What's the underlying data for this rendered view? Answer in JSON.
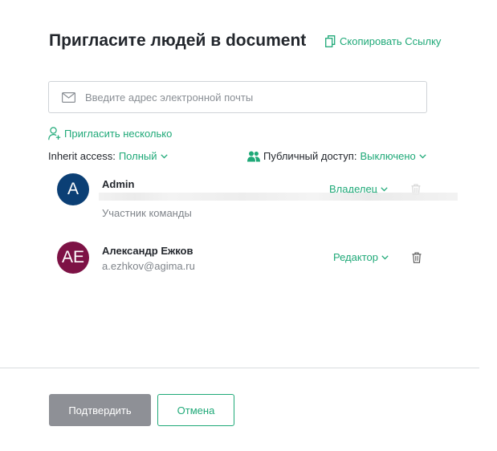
{
  "dialog": {
    "title": "Пригласите людей в document",
    "copy_link_label": "Скопировать Ссылку",
    "email": {
      "placeholder": "Введите адрес электронной почты",
      "value": ""
    },
    "invite_multiple_label": "Пригласить несколько",
    "inherit_access": {
      "label": "Inherit access:",
      "value": "Полный"
    },
    "public_access": {
      "label": "Публичный доступ:",
      "value": "Выключено"
    },
    "members": [
      {
        "initials": "A",
        "avatar_color": "#0b3f75",
        "name": "Admin",
        "subtitle": "Участник команды",
        "role": "Владелец"
      },
      {
        "initials": "АЕ",
        "avatar_color": "#7d1245",
        "name": "Александр Ежков",
        "subtitle": "a.ezhkov@agima.ru",
        "role": "Редактор"
      }
    ],
    "buttons": {
      "confirm_label": "Подтвердить",
      "cancel_label": "Отмена"
    },
    "colors": {
      "accent": "#1fa978",
      "confirm_bg": "#8e9096"
    },
    "icons": [
      "copy-icon",
      "mail-icon",
      "add-person-icon",
      "chevron-down-icon",
      "group-icon",
      "trash-icon"
    ]
  }
}
